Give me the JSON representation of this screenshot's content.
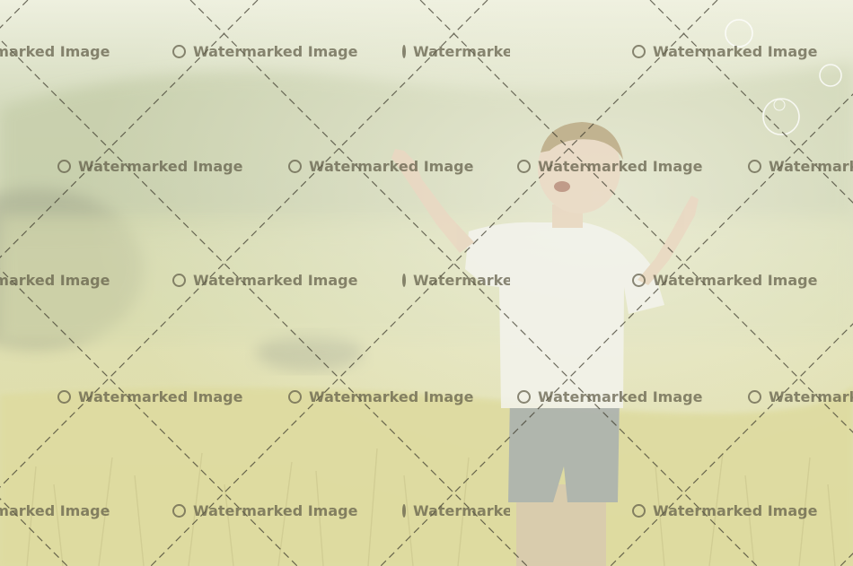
{
  "watermark": {
    "text": "Watermarked Image",
    "icon": "circle-icon",
    "color": "#5f5c46"
  },
  "photo": {
    "subject": "child-in-field",
    "palette": {
      "sky": "#e9ecd7",
      "hills": "#c9d0ad",
      "grass": "#d9d8a6",
      "shirt": "#f3f3ee",
      "shorts": "#a7aeb0",
      "skin": "#ead7c2",
      "hair": "#b9a985"
    }
  }
}
